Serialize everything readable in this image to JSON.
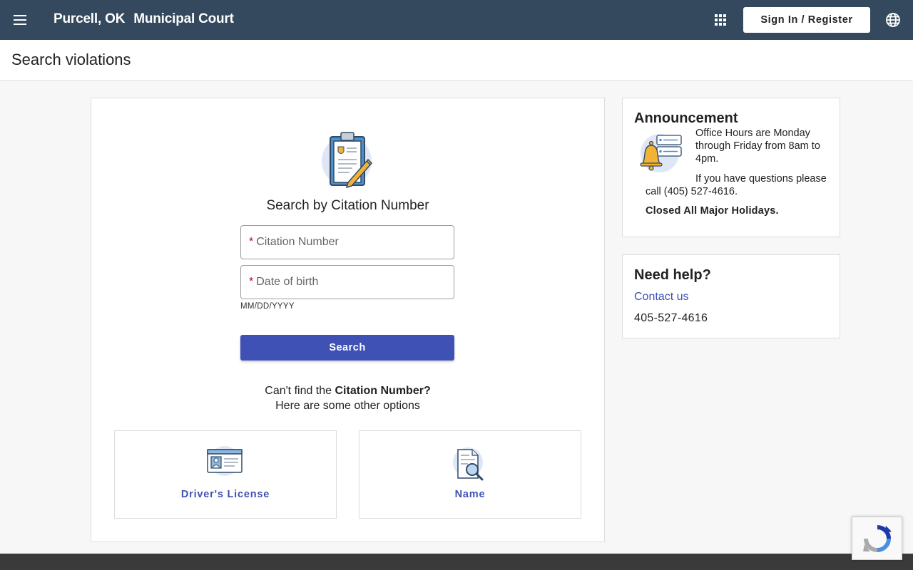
{
  "header": {
    "city": "Purcell, OK",
    "court": "Municipal Court",
    "signin_label": "Sign In / Register",
    "icons": [
      "menu-icon",
      "apps-grid-icon",
      "globe-icon"
    ]
  },
  "page": {
    "title": "Search violations"
  },
  "search": {
    "heading": "Search by Citation Number",
    "citation_placeholder": "Citation Number",
    "dob_placeholder": "Date of birth",
    "required_marker": "*",
    "dob_hint": "MM/DD/YYYY",
    "button_label": "Search",
    "cant_find_prefix": "Can't find the ",
    "cant_find_bold": "Citation Number?",
    "options_line": "Here are some other options"
  },
  "options": [
    {
      "label": "Driver's License",
      "icon": "id-card-icon"
    },
    {
      "label": "Name",
      "icon": "document-search-icon"
    }
  ],
  "announcement": {
    "title": "Announcement",
    "line1": "Office Hours are Monday through Friday from 8am to 4pm.",
    "line2": "If you have questions please call (405) 527-4616.",
    "line3": "Closed All Major Holidays."
  },
  "help": {
    "title": "Need help?",
    "link": "Contact us",
    "phone": "405-527-4616"
  },
  "colors": {
    "topbar": "#34495e",
    "primary": "#3f51b5",
    "required": "#b00020"
  }
}
